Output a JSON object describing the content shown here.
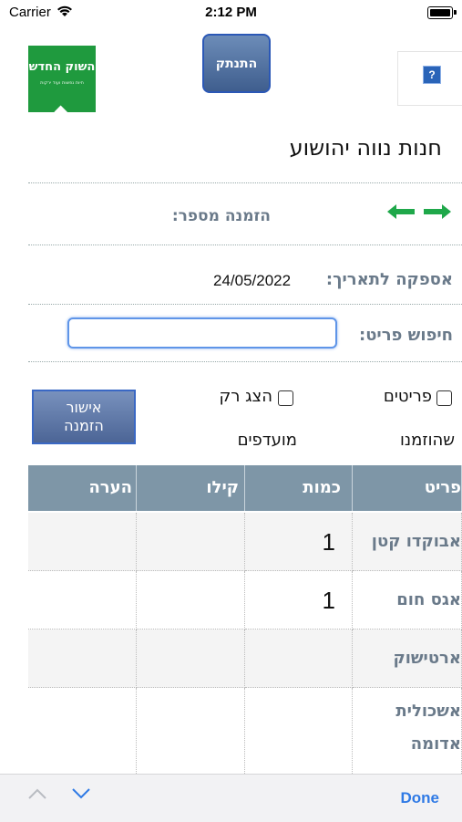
{
  "status_bar": {
    "carrier": "Carrier",
    "time": "2:12 PM"
  },
  "header": {
    "logo_title": "השוק החדש",
    "logo_subtitle": "חיות נפשות ועוד ירקות",
    "logout_label": "התנתק",
    "help_label": "?"
  },
  "store_name": "חנות נווה יהושוע",
  "order": {
    "label": "הזמנה מספר:"
  },
  "delivery": {
    "label": "אספקה לתאריך:",
    "date": "24/05/2022"
  },
  "search": {
    "label": "חיפוש פריט:",
    "value": "",
    "placeholder": ""
  },
  "filters": {
    "ordered_line1": "פריטים",
    "ordered_line2": "שהוזמנו",
    "favorites_line1": "הצג רק",
    "favorites_line2": "מועדפים"
  },
  "approve_button": {
    "line1": "אישור",
    "line2": "הזמנה"
  },
  "table": {
    "headers": [
      "פריט",
      "כמות",
      "קילו",
      "הערה"
    ],
    "rows": [
      {
        "item": "אבוקדו קטן",
        "qty": "1",
        "kilo": "",
        "note": ""
      },
      {
        "item": "אגס חום",
        "qty": "1",
        "kilo": "",
        "note": ""
      },
      {
        "item": "ארטישוק",
        "qty": "",
        "kilo": "",
        "note": ""
      },
      {
        "item_line1": "אשכולית",
        "item_line2": "אדומה",
        "qty": "",
        "kilo": "",
        "note": ""
      }
    ]
  },
  "toolbar": {
    "done_label": "Done"
  },
  "colors": {
    "header_bg": "#7e96a7",
    "accent": "#2f7ae5",
    "logo_green": "#1f9a3e",
    "arrow_green": "#1fa84a"
  }
}
